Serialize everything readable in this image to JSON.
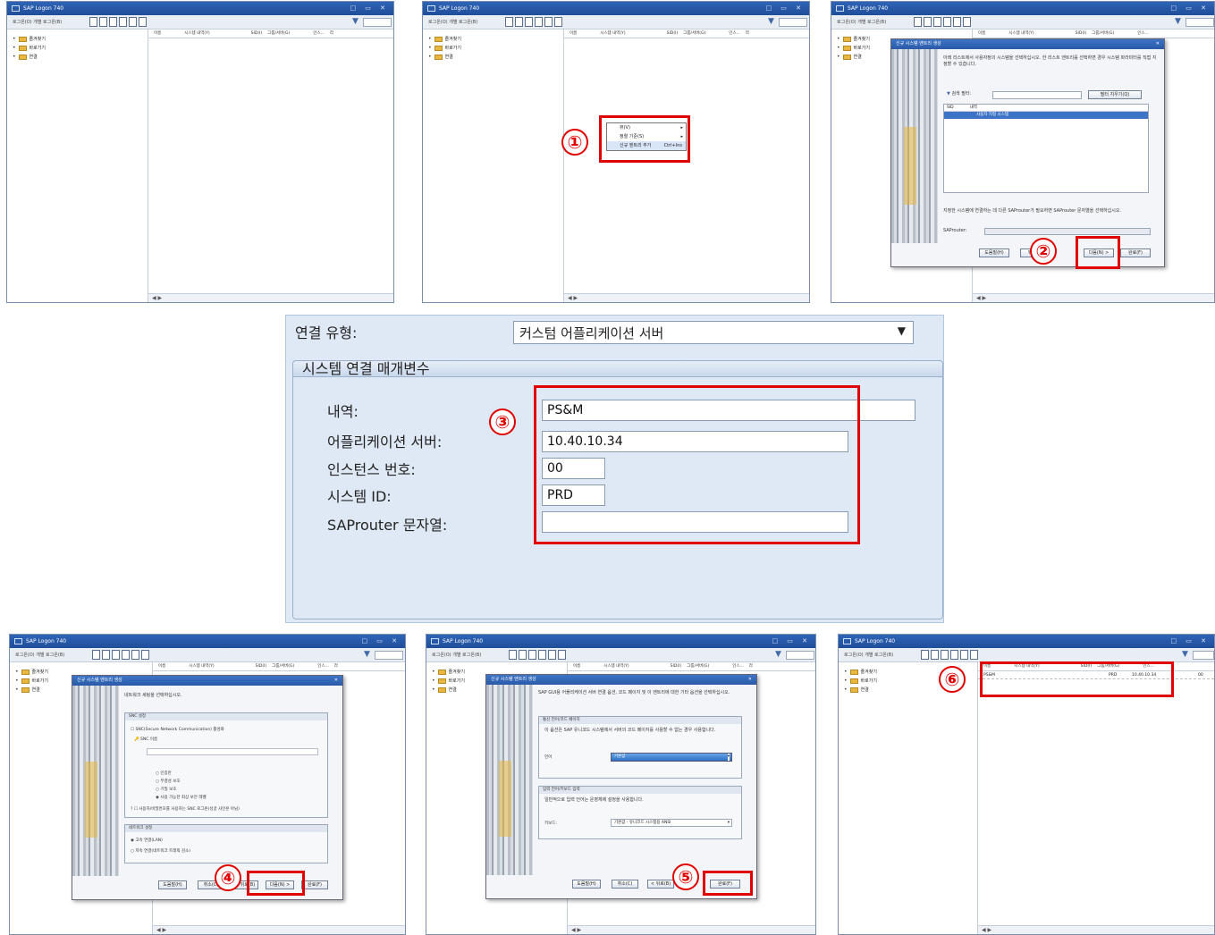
{
  "steps": [
    "①",
    "②",
    "③",
    "④",
    "⑤",
    "⑥"
  ],
  "window": {
    "title": "SAP Logon 740",
    "toolbar_label": "로그온(O)  개별 로그온(B)",
    "win_controls": "□ ▭ ✕"
  },
  "tree": {
    "items": [
      "즐겨찾기",
      "바로가기",
      "연결"
    ]
  },
  "grid": {
    "columns": [
      "이름",
      "시스템 내역(Y)",
      "SID(I)",
      "그룹/서버(G)",
      "인스...",
      "라"
    ],
    "scroll": "◀ ▶"
  },
  "context_menu": {
    "items": [
      {
        "label": "뷰(V)",
        "shortcut": ""
      },
      {
        "label": "정렬 기준(S)",
        "shortcut": ""
      },
      {
        "label": "신규 엔트리 추가",
        "shortcut": "Ctrl+Ins"
      }
    ]
  },
  "dialog_step2": {
    "title": "신규 시스템 엔트리 생성",
    "intro": "아래 리스트에서 사용자정의 시스템을 선택하십시오. 한 리스트 엔트리를 선택하면 경우 시스템 파라미터를 직접 지정할 수 있습니다.",
    "filter_label": "검색 필터:",
    "filter_btn": "필터 지우기(Q)",
    "list_cols": [
      "SID",
      "내역"
    ],
    "list_row": "사용자 지정 시스템",
    "note": "지정한 시스템에 연결하는 데 다른 SAProuter가 필요하면 SAProuter 문자열을 선택하십시오.",
    "saprouter_label": "SAProuter:",
    "buttons": [
      "도움말(H)",
      "뒤로(B)",
      "다음(N) >",
      "완료(F)"
    ]
  },
  "form": {
    "conn_type_label": "연결 유형:",
    "conn_type_value": "커스텀 어플리케이션 서버",
    "section_title": "시스템 연결 매개변수",
    "fields": [
      {
        "label": "내역:",
        "value": "PS&M"
      },
      {
        "label": "어플리케이션 서버:",
        "value": "10.40.10.34"
      },
      {
        "label": "인스턴스 번호:",
        "value": "00"
      },
      {
        "label": "시스템 ID:",
        "value": "PRD"
      },
      {
        "label": "SAProuter 문자열:",
        "value": ""
      }
    ]
  },
  "dialog_step4": {
    "title": "신규 시스템 엔트리 생성",
    "intro": "네트워크 세팅을 선택하십시오.",
    "snc_group": "SNC 설정",
    "snc_check": "SNC(Secure Network Communication) 활성화",
    "snc_name": "SNC 이름",
    "snc_options": [
      "인증만",
      "무결성 보호",
      "기밀 보호",
      "사용 가능한 최상 보안 레벨"
    ],
    "snc_sso": "사용자/비밀번호를 사용하는 SNC 로그온(싱글 사인온 아님)",
    "net_group": "네트워크 설정",
    "net_options": [
      "고속 연결(LAN)",
      "저속 연결(네트워크 트래픽 감소)"
    ],
    "buttons": [
      "도움말(H)",
      "취소(C)",
      "< 뒤로(B)",
      "다음(N) >",
      "완료(F)"
    ]
  },
  "dialog_step5": {
    "title": "신규 시스템 엔트리 생성",
    "intro": "SAP GUI용 어플리케이션 서버 연결 옵션, 코드 페이지 및 이 엔트리에 대한 기타 옵션을 선택하십시오.",
    "codepage_group": "통신 언어/코드 페이지",
    "codepage_text": "이 옵션은 SAP 유니코드 시스템에서 서버의 코드 페이지를 사용할 수 없는 경우 사용합니다.",
    "codepage_label": "언어",
    "codepage_value": "기본값",
    "keyboard_group": "입력 언어/키보드 입력",
    "keyboard_text": "일반적으로 입력 언어는 운영체제 설정을 사용합니다.",
    "keyboard_label": "키보드:",
    "keyboard_value": "기본값 - 유니코드 시스템용 ANSI",
    "buttons": [
      "도움말(H)",
      "취소(C)",
      "< 뒤로(B)",
      "완료(F)"
    ]
  },
  "result_row": {
    "name": "PS&M",
    "sid": "PRD",
    "server": "10.40.10.34",
    "inst": "00"
  }
}
